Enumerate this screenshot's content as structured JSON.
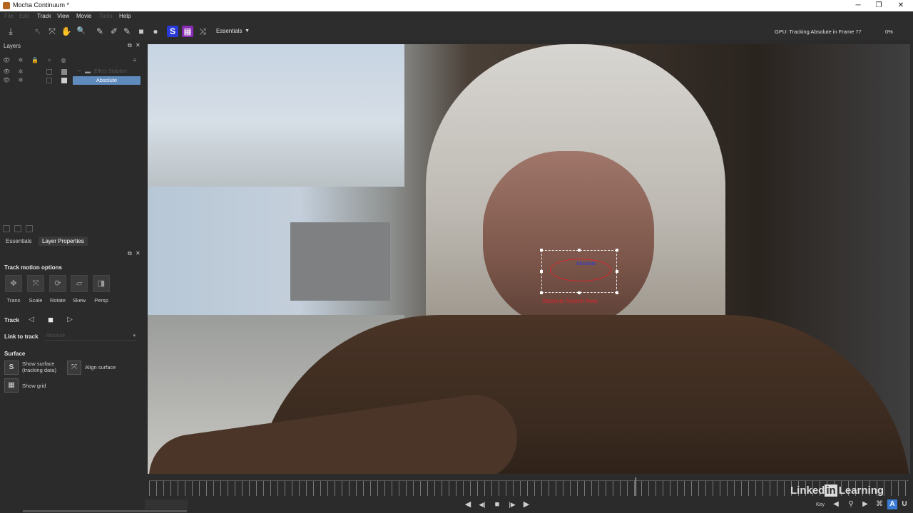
{
  "window": {
    "title": "Mocha Continuum *",
    "minimize": "─",
    "restore": "❐",
    "close": "✕"
  },
  "menu": {
    "items": [
      {
        "label": "File",
        "enabled": false
      },
      {
        "label": "Edit",
        "enabled": false
      },
      {
        "label": "Track",
        "enabled": true
      },
      {
        "label": "View",
        "enabled": true
      },
      {
        "label": "Movie",
        "enabled": true
      },
      {
        "label": "Tools",
        "enabled": false
      },
      {
        "label": "Help",
        "enabled": true
      }
    ]
  },
  "toolbar": {
    "workspace": "Essentials",
    "status": "GPU: Tracking Absolute in Frame 77",
    "progress_pct": "0%",
    "icons": {
      "save": "⤓",
      "select": "↖",
      "add_point": "⤧",
      "hand": "✋",
      "zoom": "🔍",
      "xspline": "✎",
      "bspline": "✐",
      "add_xspline": "✎",
      "add_bspline": "✐",
      "rect": "■",
      "circle": "●",
      "surface": "S",
      "grid": "▦",
      "transform": "⤨"
    }
  },
  "layers_panel": {
    "title": "Layers",
    "group_label": "Effect Stabilize",
    "selected_layer": "Absolute",
    "icons": {
      "eye": "👁",
      "gear": "✲",
      "lock": "🔒",
      "circle": "○",
      "ball": "◍",
      "menu": "≡",
      "undock": "⧉",
      "close": "✕"
    }
  },
  "props_tabs": {
    "essentials": "Essentials",
    "layer_properties": "Layer Properties"
  },
  "properties": {
    "track_motion_title": "Track motion options",
    "motion_options": [
      {
        "label": "Trans",
        "glyph": "✥"
      },
      {
        "label": "Scale",
        "glyph": "⤧"
      },
      {
        "label": "Rotate",
        "glyph": "⟳"
      },
      {
        "label": "Skew",
        "glyph": "▱"
      },
      {
        "label": "Persp",
        "glyph": "◨"
      }
    ],
    "track_label": "Track",
    "track_back": "◁",
    "track_stop": "■",
    "track_forward": "▷",
    "link_to_track_label": "Link to track",
    "link_to_track_value": "Absolute",
    "surface_title": "Surface",
    "show_surface_line1": "Show surface",
    "show_surface_line2": "(tracking data)",
    "align_surface": "Align surface",
    "show_grid": "Show grid"
  },
  "viewer": {
    "layer_name": "Absolute",
    "search_area_label": "Absolute Search Area"
  },
  "timeline": {
    "current_frame_pct": 64,
    "watermark_linked": "Linked",
    "watermark_in": "in",
    "watermark_learning": "Learning"
  },
  "transport": {
    "prev_key": "◀",
    "step_back": "◀|",
    "stop": "■",
    "step_fwd": "|▶",
    "play": "▶",
    "key_label": "Key",
    "key_prev": "◀",
    "key_add": "⚲",
    "key_next": "▶",
    "key_del": "⌘",
    "key_auto": "A",
    "key_u": "U"
  },
  "colors": {
    "selected_layer": "#5f8bbd",
    "search_area": "#d8262e",
    "layer_label": "#2a3ad8"
  }
}
